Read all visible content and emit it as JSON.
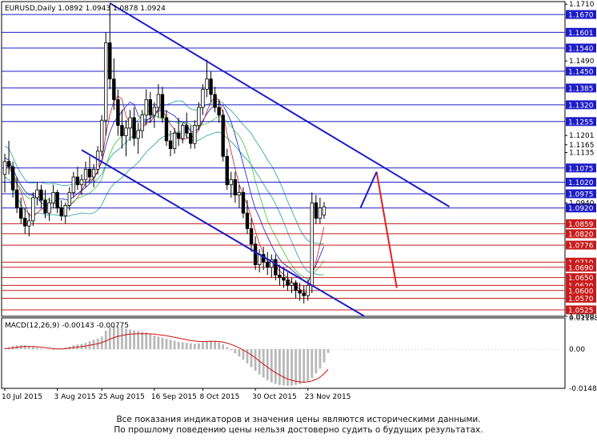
{
  "chart_data": [
    {
      "type": "candlestick",
      "title": "EURUSD,Daily",
      "ohlc_label": "1.0892 1.0943 1.0878 1.0924",
      "ylim": [
        1.05,
        1.172
      ],
      "x_tick_labels": [
        "10 Jul 2015",
        "3 Aug 2015",
        "25 Aug 2015",
        "16 Sep 2015",
        "8 Oct 2015",
        "30 Oct 2015",
        "23 Nov 2015"
      ],
      "y_tick_labels": [
        "1.1710",
        "1.1490",
        "1.1201",
        "1.1165",
        "1.1135",
        "1.0940",
        "1.0500"
      ],
      "candles": [
        [
          1.105,
          1.113,
          1.098,
          1.11
        ],
        [
          1.11,
          1.118,
          1.105,
          1.108
        ],
        [
          1.108,
          1.11,
          1.096,
          1.099
        ],
        [
          1.099,
          1.104,
          1.09,
          1.092
        ],
        [
          1.092,
          1.096,
          1.086,
          1.088
        ],
        [
          1.088,
          1.092,
          1.082,
          1.085
        ],
        [
          1.085,
          1.09,
          1.081,
          1.087
        ],
        [
          1.087,
          1.098,
          1.085,
          1.096
        ],
        [
          1.096,
          1.102,
          1.093,
          1.099
        ],
        [
          1.099,
          1.101,
          1.092,
          1.095
        ],
        [
          1.095,
          1.099,
          1.088,
          1.09
        ],
        [
          1.09,
          1.096,
          1.087,
          1.094
        ],
        [
          1.094,
          1.101,
          1.092,
          1.098
        ],
        [
          1.098,
          1.099,
          1.09,
          1.092
        ],
        [
          1.092,
          1.095,
          1.087,
          1.089
        ],
        [
          1.089,
          1.094,
          1.086,
          1.093
        ],
        [
          1.093,
          1.1,
          1.091,
          1.098
        ],
        [
          1.098,
          1.106,
          1.096,
          1.104
        ],
        [
          1.104,
          1.108,
          1.099,
          1.101
        ],
        [
          1.101,
          1.105,
          1.097,
          1.103
        ],
        [
          1.103,
          1.11,
          1.1,
          1.107
        ],
        [
          1.107,
          1.112,
          1.102,
          1.104
        ],
        [
          1.104,
          1.109,
          1.1,
          1.107
        ],
        [
          1.107,
          1.116,
          1.105,
          1.114
        ],
        [
          1.114,
          1.128,
          1.112,
          1.126
        ],
        [
          1.126,
          1.16,
          1.12,
          1.156
        ],
        [
          1.156,
          1.1714,
          1.138,
          1.142
        ],
        [
          1.142,
          1.15,
          1.13,
          1.134
        ],
        [
          1.134,
          1.138,
          1.12,
          1.124
        ],
        [
          1.124,
          1.13,
          1.115,
          1.12
        ],
        [
          1.12,
          1.126,
          1.112,
          1.123
        ],
        [
          1.123,
          1.13,
          1.118,
          1.127
        ],
        [
          1.127,
          1.131,
          1.116,
          1.119
        ],
        [
          1.119,
          1.125,
          1.113,
          1.122
        ],
        [
          1.122,
          1.13,
          1.119,
          1.128
        ],
        [
          1.128,
          1.138,
          1.124,
          1.134
        ],
        [
          1.134,
          1.137,
          1.125,
          1.128
        ],
        [
          1.128,
          1.133,
          1.123,
          1.131
        ],
        [
          1.131,
          1.14,
          1.127,
          1.136
        ],
        [
          1.136,
          1.139,
          1.125,
          1.127
        ],
        [
          1.127,
          1.13,
          1.116,
          1.118
        ],
        [
          1.118,
          1.122,
          1.112,
          1.115
        ],
        [
          1.115,
          1.123,
          1.113,
          1.121
        ],
        [
          1.121,
          1.127,
          1.116,
          1.119
        ],
        [
          1.119,
          1.125,
          1.117,
          1.124
        ],
        [
          1.124,
          1.129,
          1.119,
          1.121
        ],
        [
          1.121,
          1.124,
          1.115,
          1.117
        ],
        [
          1.117,
          1.126,
          1.115,
          1.124
        ],
        [
          1.124,
          1.133,
          1.122,
          1.131
        ],
        [
          1.131,
          1.14,
          1.128,
          1.138
        ],
        [
          1.138,
          1.1495,
          1.135,
          1.142
        ],
        [
          1.142,
          1.145,
          1.133,
          1.136
        ],
        [
          1.136,
          1.139,
          1.129,
          1.131
        ],
        [
          1.131,
          1.134,
          1.125,
          1.128
        ],
        [
          1.128,
          1.13,
          1.11,
          1.112
        ],
        [
          1.112,
          1.115,
          1.099,
          1.101
        ],
        [
          1.101,
          1.106,
          1.096,
          1.103
        ],
        [
          1.103,
          1.106,
          1.094,
          1.097
        ],
        [
          1.097,
          1.101,
          1.092,
          1.098
        ],
        [
          1.098,
          1.1,
          1.088,
          1.09
        ],
        [
          1.09,
          1.095,
          1.082,
          1.084
        ],
        [
          1.084,
          1.088,
          1.075,
          1.078
        ],
        [
          1.078,
          1.081,
          1.068,
          1.07
        ],
        [
          1.07,
          1.076,
          1.067,
          1.074
        ],
        [
          1.074,
          1.077,
          1.068,
          1.071
        ],
        [
          1.071,
          1.075,
          1.066,
          1.069
        ],
        [
          1.069,
          1.074,
          1.065,
          1.072
        ],
        [
          1.072,
          1.074,
          1.064,
          1.066
        ],
        [
          1.066,
          1.07,
          1.062,
          1.065
        ],
        [
          1.065,
          1.069,
          1.061,
          1.064
        ],
        [
          1.064,
          1.067,
          1.06,
          1.062
        ],
        [
          1.062,
          1.065,
          1.059,
          1.063
        ],
        [
          1.063,
          1.064,
          1.057,
          1.06
        ],
        [
          1.06,
          1.063,
          1.056,
          1.059
        ],
        [
          1.059,
          1.062,
          1.055,
          1.058
        ],
        [
          1.058,
          1.064,
          1.056,
          1.062
        ],
        [
          1.062,
          1.098,
          1.059,
          1.094
        ],
        [
          1.094,
          1.097,
          1.086,
          1.088
        ],
        [
          1.088,
          1.096,
          1.086,
          1.092
        ],
        [
          1.0892,
          1.0943,
          1.0878,
          1.0924
        ]
      ],
      "horizontal_levels": [
        {
          "label": "1.1670",
          "value": 1.167,
          "color": "#1c1cc8"
        },
        {
          "label": "1.1601",
          "value": 1.1601,
          "color": "#1c1cc8"
        },
        {
          "label": "1.1540",
          "value": 1.154,
          "color": "#1c1cc8"
        },
        {
          "label": "1.1450",
          "value": 1.145,
          "color": "#1c1cc8"
        },
        {
          "label": "1.1385",
          "value": 1.1385,
          "color": "#1c1cc8"
        },
        {
          "label": "1.1320",
          "value": 1.132,
          "color": "#1c1cc8"
        },
        {
          "label": "1.1255",
          "value": 1.1255,
          "color": "#1c1cc8"
        },
        {
          "label": "1.1075",
          "value": 1.1075,
          "color": "#1c1cc8"
        },
        {
          "label": "1.1020",
          "value": 1.102,
          "color": "#1c1cc8"
        },
        {
          "label": "1.0975",
          "value": 1.0975,
          "color": "#1c1cc8"
        },
        {
          "label": "1.0920",
          "value": 1.092,
          "color": "#1c1cc8"
        },
        {
          "label": "1.0859",
          "value": 1.0859,
          "color": "#c81c1c"
        },
        {
          "label": "1.0820",
          "value": 1.082,
          "color": "#c81c1c"
        },
        {
          "label": "1.0776",
          "value": 1.0776,
          "color": "#c81c1c"
        },
        {
          "label": "1.0710",
          "value": 1.071,
          "color": "#c81c1c"
        },
        {
          "label": "1.0690",
          "value": 1.069,
          "color": "#c81c1c"
        },
        {
          "label": "1.0650",
          "value": 1.065,
          "color": "#c81c1c"
        },
        {
          "label": "1.0620",
          "value": 1.062,
          "color": "#c81c1c"
        },
        {
          "label": "1.0600",
          "value": 1.06,
          "color": "#c81c1c"
        },
        {
          "label": "1.0570",
          "value": 1.057,
          "color": "#c81c1c"
        },
        {
          "label": "1.0525",
          "value": 1.0525,
          "color": "#c81c1c"
        }
      ],
      "trend_lines": [
        {
          "name": "upper-channel",
          "color": "#1c1cc8",
          "points": [
            [
              26,
              1.1714
            ],
            [
              110,
              1.0925
            ]
          ]
        },
        {
          "name": "lower-channel",
          "color": "#1c1cc8",
          "points": [
            [
              19,
              1.1145
            ],
            [
              89,
              1.05
            ]
          ]
        },
        {
          "name": "forecast",
          "color": "#e02020",
          "points": [
            [
              92,
              1.106
            ],
            [
              97,
              1.061
            ]
          ]
        },
        {
          "name": "forecast-up",
          "color": "#1c1cc8",
          "points": [
            [
              88,
              1.092
            ],
            [
              92,
              1.106
            ]
          ]
        }
      ],
      "colors": {
        "bull": "#000000",
        "bear": "#000000",
        "level_up": "#1c1cc8",
        "level_down": "#c81c1c"
      }
    },
    {
      "type": "bar",
      "title": "MACD(12,26,9) -0.00143 -0.00775",
      "ylim": [
        -0.01487,
        0.01188
      ],
      "y_tick_labels": [
        "0.01188",
        "0.00",
        "-0.01487"
      ],
      "histogram": [
        0.0005,
        0.0008,
        0.0012,
        0.0015,
        0.0016,
        0.0015,
        0.0012,
        0.001,
        0.0006,
        0.0003,
        0.0,
        -0.0002,
        -0.0003,
        -0.0001,
        0.0002,
        0.0006,
        0.001,
        0.0015,
        0.0018,
        0.002,
        0.0024,
        0.003,
        0.0036,
        0.004,
        0.0048,
        0.007,
        0.0085,
        0.0088,
        0.0086,
        0.0082,
        0.0078,
        0.0075,
        0.0072,
        0.0069,
        0.0066,
        0.0063,
        0.0058,
        0.0052,
        0.0048,
        0.0044,
        0.004,
        0.0036,
        0.0032,
        0.0028,
        0.0026,
        0.0024,
        0.0022,
        0.002,
        0.0022,
        0.0026,
        0.003,
        0.0032,
        0.003,
        0.0026,
        0.0018,
        0.0008,
        -0.0004,
        -0.0016,
        -0.0028,
        -0.004,
        -0.0054,
        -0.0068,
        -0.0082,
        -0.0096,
        -0.0108,
        -0.0118,
        -0.0126,
        -0.0132,
        -0.0136,
        -0.0138,
        -0.0139,
        -0.0138,
        -0.0136,
        -0.0133,
        -0.0128,
        -0.0122,
        -0.011,
        -0.0092,
        -0.0074,
        -0.005,
        -0.0014
      ],
      "signal": [
        0.0002,
        0.0003,
        0.0005,
        0.0007,
        0.0009,
        0.001,
        0.001,
        0.001,
        0.0009,
        0.0008,
        0.0006,
        0.0004,
        0.0002,
        0.0001,
        0.0001,
        0.0002,
        0.0004,
        0.0006,
        0.0008,
        0.001,
        0.0012,
        0.0015,
        0.0018,
        0.0021,
        0.0025,
        0.0031,
        0.0038,
        0.0044,
        0.0049,
        0.0052,
        0.0055,
        0.0057,
        0.0058,
        0.0059,
        0.0059,
        0.0059,
        0.0058,
        0.0057,
        0.0055,
        0.0053,
        0.0051,
        0.0048,
        0.0045,
        0.0042,
        0.0039,
        0.0036,
        0.0033,
        0.0031,
        0.0029,
        0.0029,
        0.0029,
        0.003,
        0.003,
        0.0029,
        0.0027,
        0.0023,
        0.0018,
        0.0012,
        0.0005,
        -0.0003,
        -0.0012,
        -0.0022,
        -0.0033,
        -0.0045,
        -0.0057,
        -0.0068,
        -0.0079,
        -0.0089,
        -0.0098,
        -0.0106,
        -0.0113,
        -0.0118,
        -0.0122,
        -0.0124,
        -0.0125,
        -0.0124,
        -0.0121,
        -0.0115,
        -0.0106,
        -0.0093,
        -0.0077
      ]
    }
  ],
  "disclaimer": {
    "line1": "Все показания индикаторов и значения цены являются историческими данными.",
    "line2": "По прошлому поведению цены нельзя достоверно судить о будущих результатах."
  }
}
